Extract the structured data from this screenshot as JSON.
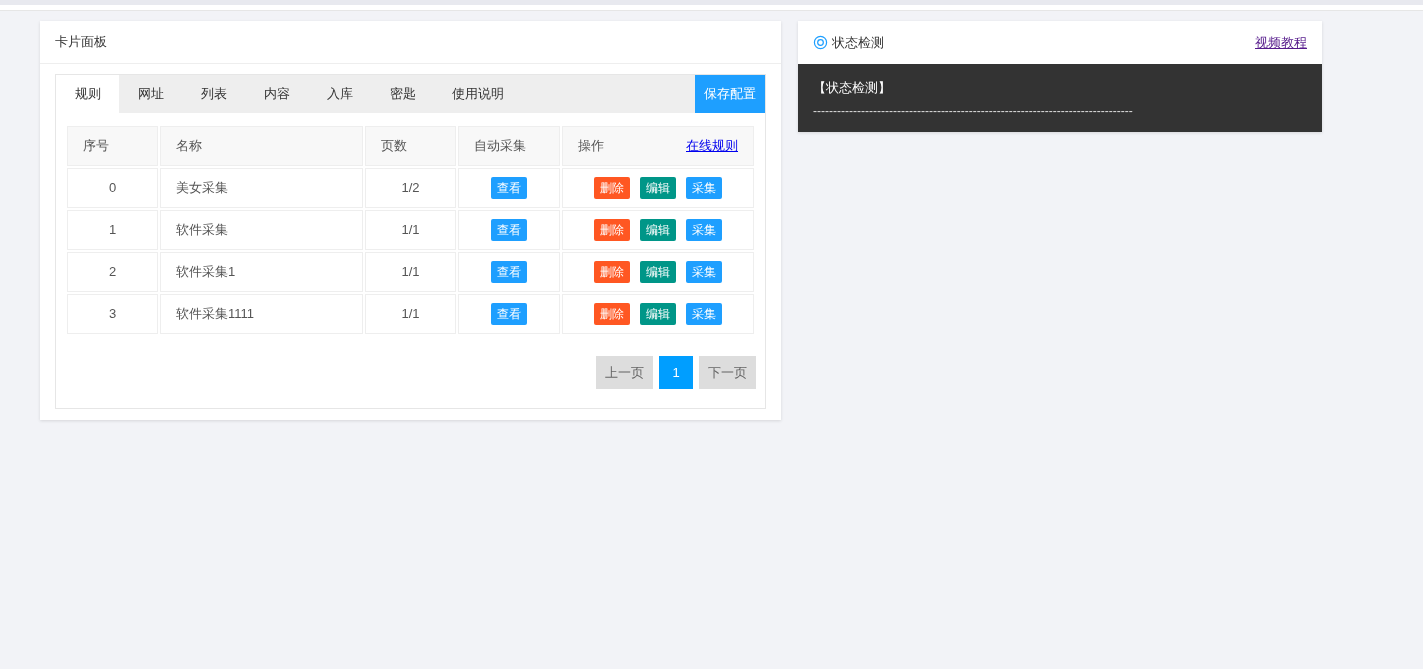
{
  "card": {
    "title": "卡片面板"
  },
  "tabs": [
    {
      "label": "规则",
      "selected": true
    },
    {
      "label": "网址",
      "selected": false
    },
    {
      "label": "列表",
      "selected": false
    },
    {
      "label": "内容",
      "selected": false
    },
    {
      "label": "入库",
      "selected": false
    },
    {
      "label": "密匙",
      "selected": false
    },
    {
      "label": "使用说明",
      "selected": false
    }
  ],
  "save_button": "保存配置",
  "table": {
    "columns": [
      "序号",
      "名称",
      "页数",
      "自动采集",
      "操作"
    ],
    "online_rules_link": "在线规则",
    "rows": [
      {
        "index": "0",
        "name": "美女采集",
        "pages": "1/2",
        "view": "查看",
        "actions": [
          {
            "label": "删除",
            "kind": "danger"
          },
          {
            "label": "编辑",
            "kind": "edit"
          },
          {
            "label": "采集",
            "kind": "primary"
          }
        ]
      },
      {
        "index": "1",
        "name": "软件采集",
        "pages": "1/1",
        "view": "查看",
        "actions": [
          {
            "label": "删除",
            "kind": "danger"
          },
          {
            "label": "编辑",
            "kind": "edit"
          },
          {
            "label": "采集",
            "kind": "primary"
          }
        ]
      },
      {
        "index": "2",
        "name": "软件采集1",
        "pages": "1/1",
        "view": "查看",
        "actions": [
          {
            "label": "删除",
            "kind": "danger"
          },
          {
            "label": "编辑",
            "kind": "edit"
          },
          {
            "label": "采集",
            "kind": "primary"
          }
        ]
      },
      {
        "index": "3",
        "name": "软件采集1111",
        "pages": "1/1",
        "view": "查看",
        "actions": [
          {
            "label": "删除",
            "kind": "danger"
          },
          {
            "label": "编辑",
            "kind": "edit"
          },
          {
            "label": "采集",
            "kind": "primary"
          }
        ]
      }
    ]
  },
  "pagination": {
    "prev": "上一页",
    "pages": [
      {
        "label": "1",
        "selected": true
      }
    ],
    "next": "下一页"
  },
  "status_panel": {
    "title": "状态检测",
    "link": "视频教程",
    "console_heading": "【状态检测】",
    "console_line": "--------------------------------------------------------------------------------"
  }
}
